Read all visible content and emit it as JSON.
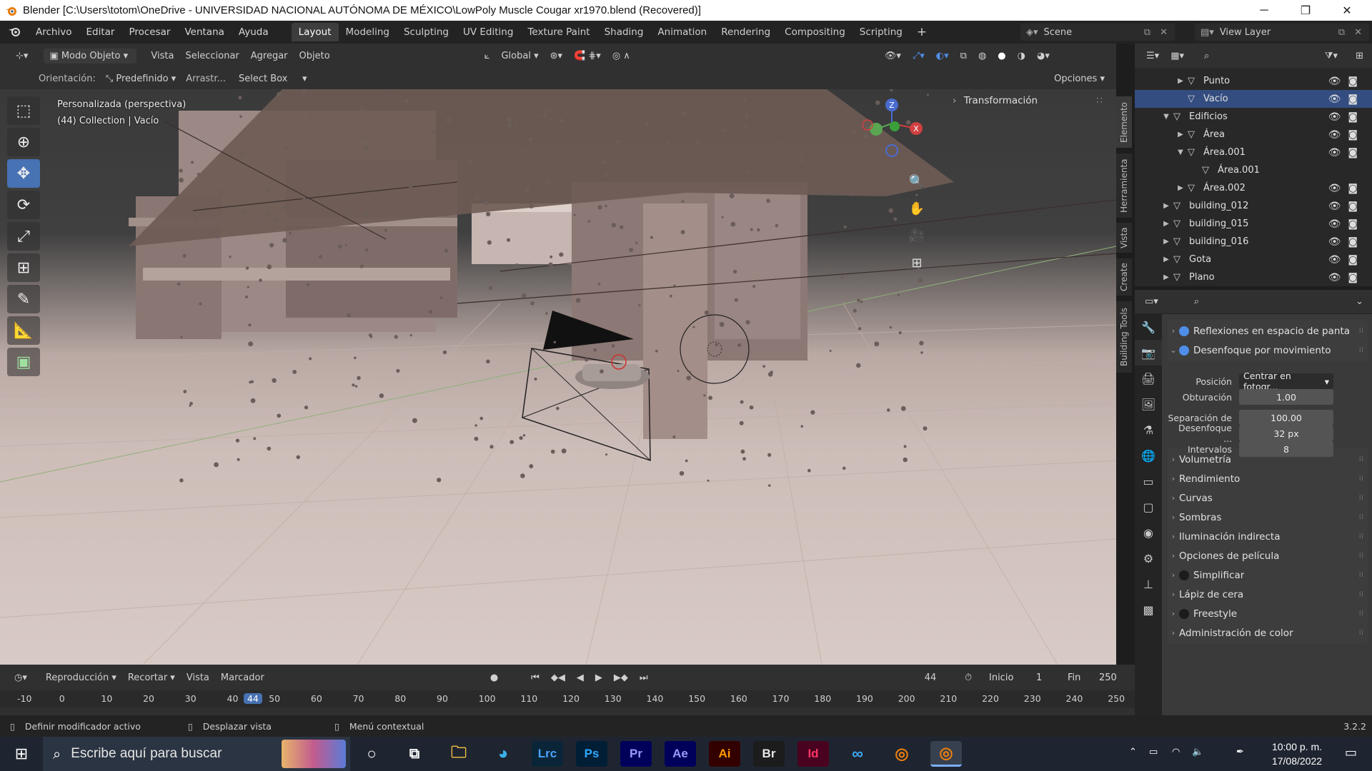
{
  "titlebar": {
    "title": "Blender [C:\\Users\\totom\\OneDrive - UNIVERSIDAD NACIONAL AUTÓNOMA DE MÉXICO\\LowPoly Muscle Cougar xr1970.blend (Recovered)]",
    "minimize": "─",
    "restore": "❐",
    "close": "✕"
  },
  "menu": [
    "Archivo",
    "Editar",
    "Procesar",
    "Ventana",
    "Ayuda"
  ],
  "workspaces": [
    "Layout",
    "Modeling",
    "Sculpting",
    "UV Editing",
    "Texture Paint",
    "Shading",
    "Animation",
    "Rendering",
    "Compositing",
    "Scripting",
    "+"
  ],
  "scene": "Scene",
  "view_layer": "View Layer",
  "viewport_header": {
    "mode": "Modo Objeto",
    "menus": [
      "Vista",
      "Seleccionar",
      "Agregar",
      "Objeto"
    ],
    "transform_orientation": "Global"
  },
  "tool_header": {
    "orientation_label": "Orientación:",
    "orientation_value": "Predefinido",
    "drag_label": "Arrastr...",
    "drag_value": "Select Box",
    "options": "Opciones"
  },
  "viewport": {
    "view_name": "Personalizada (perspectiva)",
    "context": "(44) Collection | Vacío",
    "n_panel_title": "Transformación",
    "gizmo": {
      "z": "Z",
      "x": "X"
    }
  },
  "sidebar_tabs": [
    "Elemento",
    "Herramienta",
    "Vista",
    "Create",
    "Building Tools"
  ],
  "outliner": {
    "rows": [
      {
        "label": "Punto",
        "expanded": false,
        "indent": 2
      },
      {
        "label": "Vacío",
        "expanded": null,
        "indent": 2,
        "selected": true
      },
      {
        "label": "Edificios",
        "expanded": true,
        "indent": 1
      },
      {
        "label": "Área",
        "expanded": false,
        "indent": 2
      },
      {
        "label": "Área.001",
        "expanded": true,
        "indent": 2
      },
      {
        "label": "Área.001",
        "expanded": null,
        "indent": 3
      },
      {
        "label": "Área.002",
        "expanded": false,
        "indent": 2
      },
      {
        "label": "building_012",
        "expanded": false,
        "indent": 1
      },
      {
        "label": "building_015",
        "expanded": false,
        "indent": 1
      },
      {
        "label": "building_016",
        "expanded": false,
        "indent": 1
      },
      {
        "label": "Gota",
        "expanded": false,
        "indent": 1
      },
      {
        "label": "Plano",
        "expanded": false,
        "indent": 1
      }
    ]
  },
  "properties": {
    "sections": [
      {
        "label": "Reflexiones en espacio de pantalla",
        "toggle": "on",
        "open": false
      },
      {
        "label": "Desenfoque por movimiento",
        "toggle": "on",
        "open": true
      },
      {
        "label": "Volumetría",
        "toggle": null,
        "open": false
      },
      {
        "label": "Rendimiento",
        "toggle": null,
        "open": false
      },
      {
        "label": "Curvas",
        "toggle": null,
        "open": false
      },
      {
        "label": "Sombras",
        "toggle": null,
        "open": false
      },
      {
        "label": "Iluminación indirecta",
        "toggle": null,
        "open": false
      },
      {
        "label": "Opciones de película",
        "toggle": null,
        "open": false
      },
      {
        "label": "Simplificar",
        "toggle": "off",
        "open": false
      },
      {
        "label": "Lápiz de cera",
        "toggle": null,
        "open": false
      },
      {
        "label": "Freestyle",
        "toggle": "off",
        "open": false
      },
      {
        "label": "Administración de color",
        "toggle": null,
        "open": false
      }
    ],
    "motion_blur": {
      "position_label": "Posición",
      "position_value": "Centrar en fotogr...",
      "shutter_label": "Obturación",
      "shutter_value": "1.00",
      "bg_sep_label": "Separación de",
      "bg_sep_value": "100.00",
      "max_blur_label": "Desenfoque ...",
      "max_blur_value": "32 px",
      "steps_label": "Intervalos",
      "steps_value": "8"
    }
  },
  "timeline": {
    "menus": [
      "Reproducción",
      "Recortar",
      "Vista",
      "Marcador"
    ],
    "current_frame": "44",
    "start_label": "Inicio",
    "start": "1",
    "end_label": "Fin",
    "end": "250",
    "ticks": [
      "-10",
      "0",
      "10",
      "20",
      "30",
      "40",
      "44",
      "50",
      "60",
      "70",
      "80",
      "90",
      "100",
      "110",
      "120",
      "130",
      "140",
      "150",
      "160",
      "170",
      "180",
      "190",
      "200",
      "210",
      "220",
      "230",
      "240",
      "250"
    ]
  },
  "statusbar": {
    "item1": "Definir modificador activo",
    "item2": "Desplazar vista",
    "item3": "Menú contextual",
    "version": "3.2.2"
  },
  "taskbar": {
    "search_placeholder": "Escribe aquí para buscar",
    "apps": [
      "Lrc",
      "Ps",
      "Pr",
      "Ae",
      "Ai",
      "Br",
      "Id"
    ],
    "time": "10:00 p. m.",
    "date": "17/08/2022"
  },
  "colors": {
    "accent": "#4772b3",
    "selected_row": "#334d80",
    "toggle_on": "#4f8ee8"
  }
}
